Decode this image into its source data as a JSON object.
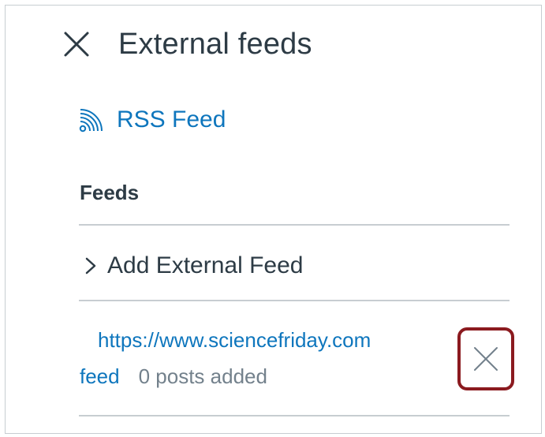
{
  "header": {
    "title": "External feeds",
    "close_icon": "close-icon"
  },
  "rss": {
    "label": "RSS Feed",
    "icon": "rss-icon"
  },
  "feeds": {
    "heading": "Feeds",
    "add_label": "Add External Feed",
    "add_icon": "chevron-right-icon",
    "items": [
      {
        "url_line1": "https://www.sciencefriday.com",
        "url_line2": "feed",
        "status": "0 posts added",
        "delete_icon": "close-icon"
      }
    ]
  },
  "colors": {
    "link": "#0e76bd",
    "text": "#2d3b45",
    "muted": "#73818c",
    "divider": "#c7cdd1",
    "highlight": "#8b1a1f"
  }
}
